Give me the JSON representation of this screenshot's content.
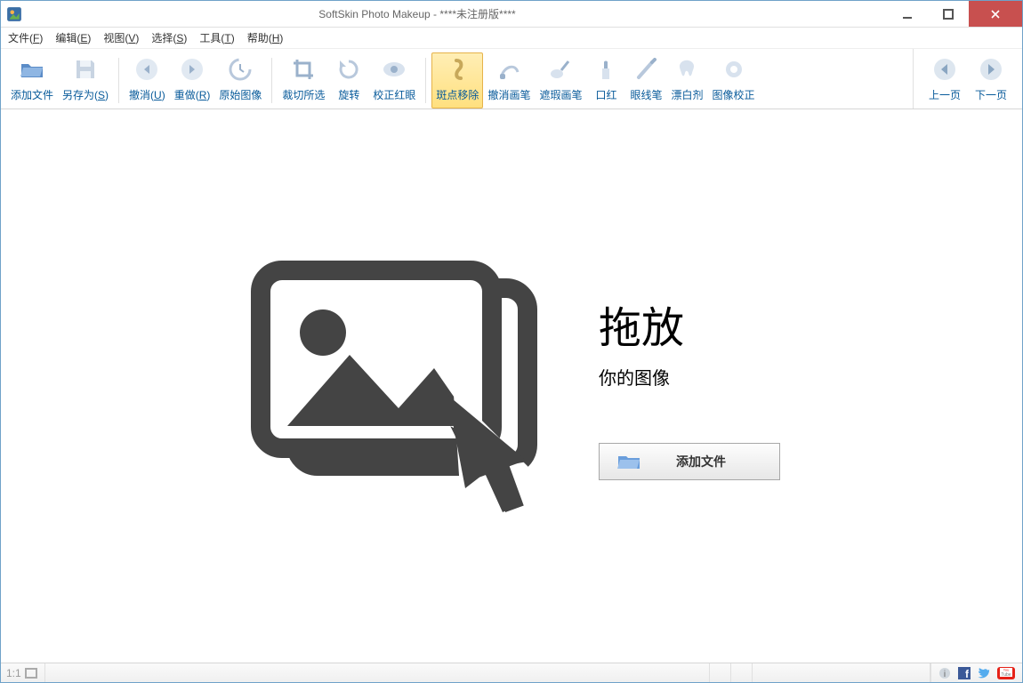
{
  "title": "SoftSkin Photo Makeup - ****未注册版****",
  "menus": {
    "file": {
      "pre": "文件(",
      "u": "F",
      "post": ")"
    },
    "edit": {
      "pre": "编辑(",
      "u": "E",
      "post": ")"
    },
    "view": {
      "pre": "视图(",
      "u": "V",
      "post": ")"
    },
    "select": {
      "pre": "选择(",
      "u": "S",
      "post": ")"
    },
    "tools": {
      "pre": "工具(",
      "u": "T",
      "post": ")"
    },
    "help": {
      "pre": "帮助(",
      "u": "H",
      "post": ")"
    }
  },
  "toolbar": {
    "add_files": "添加文件",
    "save_as": {
      "pre": "另存为(",
      "u": "S",
      "post": ")"
    },
    "undo": {
      "pre": "撤消(",
      "u": "U",
      "post": ")"
    },
    "redo": {
      "pre": "重做(",
      "u": "R",
      "post": ")"
    },
    "original": "原始图像",
    "crop": "裁切所选",
    "rotate": "旋转",
    "redeye": "校正红眼",
    "spot_remove": "斑点移除",
    "undo_brush": "撤消画笔",
    "conceal": "遮瑕画笔",
    "lipstick": "口红",
    "eyeliner": "眼线笔",
    "bleach": "漂白剂",
    "correction": "图像校正",
    "prev": "上一页",
    "next": "下一页"
  },
  "drop": {
    "heading": "拖放",
    "sub": "你的图像",
    "button": "添加文件"
  },
  "status": {
    "ratio": "1:1"
  }
}
